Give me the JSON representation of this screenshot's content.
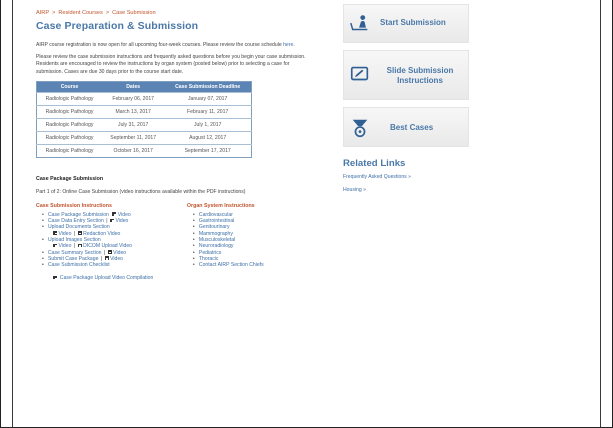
{
  "breadcrumb": [
    "AIRP",
    "Resident Courses",
    "Case Submission"
  ],
  "breadcrumb_sep": ">",
  "page_title": "Case Preparation & Submission",
  "intro": {
    "text": "AIRP course registration is now open for all upcoming four-week courses.  Please review the course schedule",
    "link": "here",
    "end": "."
  },
  "instructions_paragraph": "Please review the case submission instructions and frequently asked questions before you begin your case submission. Residents are encouraged to review the instructions by organ system (posted below) prior to selecting a case for submission. Cases are due 30 days prior to the course start date.",
  "schedule": {
    "headers": [
      "Course",
      "Dates",
      "Case Submission Deadline"
    ],
    "rows": [
      [
        "Radiologic Pathology",
        "February 06, 2017",
        "January 07, 2017"
      ],
      [
        "Radiologic Pathology",
        "March 13, 2017",
        "February 11, 2017"
      ],
      [
        "Radiologic Pathology",
        "July 31, 2017",
        "July 1, 2017"
      ],
      [
        "Radiologic Pathology",
        "September 11, 2017",
        "August 12, 2017"
      ],
      [
        "Radiologic Pathology",
        "October 16, 2017",
        "September 17, 2017"
      ]
    ]
  },
  "package_heading": "Case Package Submission",
  "part_line": "Part 1 of 2:  Online Case Submission (video instructions available within the PDF instructions)",
  "case_instructions": {
    "heading": "Case Submission Instructions",
    "video_label": "Video",
    "items": [
      {
        "label": "Case Package Submission",
        "video": true
      },
      {
        "label": "Case Data Entry Section",
        "video": true
      },
      {
        "label": "Upload Documents Section",
        "video": false
      },
      {
        "label": "Upload Images Section",
        "video": false
      },
      {
        "label": "Case Summary Section",
        "video": true
      },
      {
        "label": "Submit Case Package",
        "video": true
      },
      {
        "label": "Case Submission Checklist",
        "video": false
      }
    ],
    "upload_docs_videos": [
      "Video",
      "Redaction Video"
    ],
    "upload_images_videos": [
      "Video",
      "DICOM Upload Video"
    ]
  },
  "organ_instructions": {
    "heading": "Organ System Instructions",
    "items": [
      "Cardiovascular",
      "Gastrointestinal",
      "Genitourinary",
      "Mammography",
      "Musculoskeletal",
      "Neuroradiology",
      "Pediatrics",
      "Thoracic",
      "Contact AIRP Section Chiefs"
    ]
  },
  "compilation_link": "Case Package Upload Video Compilation",
  "sidebar": {
    "start_label": "Start Submission",
    "slide_label": "Slide Submission Instructions",
    "best_label": "Best Cases",
    "icons": [
      "person-desk-icon",
      "edit-screen-icon",
      "award-ribbon-icon"
    ]
  },
  "related": {
    "title": "Related Links",
    "links": [
      "Frequently Asked Questions »",
      "Housing »"
    ]
  },
  "colors": {
    "accent_blue": "#4a78a8",
    "link_blue": "#3d6fa8",
    "accent_orange": "#c0552f",
    "table_header": "#5b84b4"
  }
}
